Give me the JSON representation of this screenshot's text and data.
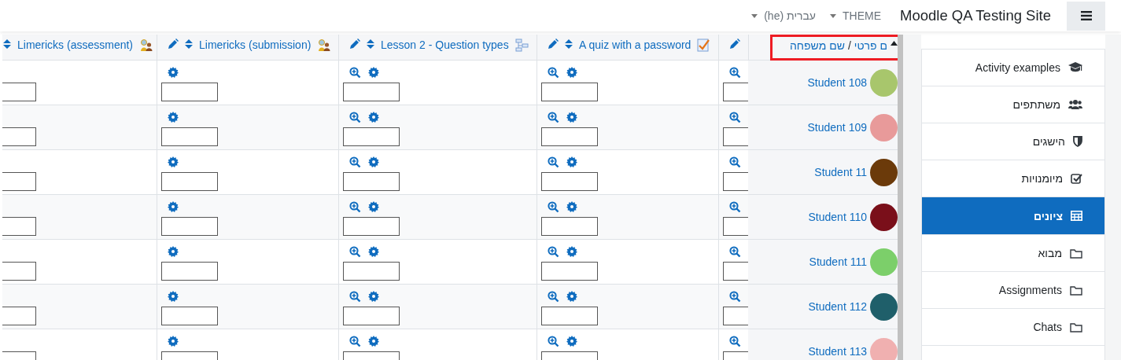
{
  "navbar": {
    "site_title": "Moodle QA Testing Site",
    "theme_menu": "THEME",
    "language_menu": "עברית (he)"
  },
  "grader": {
    "name_header": {
      "first_name": "ם פרטי",
      "separator": "/",
      "last_name": "שם משפחה",
      "sorted": true,
      "highlighted": true
    },
    "columns": [
      {
        "kind": "edit-only"
      },
      {
        "kind": "item",
        "title": "A quiz with a password"
      },
      {
        "kind": "item",
        "title": "Lesson 2 - Question types"
      },
      {
        "kind": "item",
        "title": "Limericks (submission)"
      },
      {
        "kind": "item",
        "title": "Limericks (assessment)"
      }
    ],
    "rows": [
      {
        "name": "Student 108",
        "color": "#a8c66c"
      },
      {
        "name": "Student 109",
        "color": "#e89a9a"
      },
      {
        "name": "Student 11",
        "color": "#6b3a0a"
      },
      {
        "name": "Student 110",
        "color": "#7a0f1a"
      },
      {
        "name": "Student 111",
        "color": "#7ccf6a"
      },
      {
        "name": "Student 112",
        "color": "#1f5f6a"
      },
      {
        "name": "Student 113",
        "color": "#f0b0b0"
      }
    ]
  },
  "sidebar": {
    "items": [
      {
        "label": "Activity examples",
        "selected": false
      },
      {
        "label": "משתתפים",
        "selected": false
      },
      {
        "label": "הישגים",
        "selected": false
      },
      {
        "label": "מיומנויות",
        "selected": false
      },
      {
        "label": "ציונים",
        "selected": true
      },
      {
        "label": "מבוא",
        "selected": false
      },
      {
        "label": "Assignments",
        "selected": false
      },
      {
        "label": "Chats",
        "selected": false
      }
    ]
  }
}
